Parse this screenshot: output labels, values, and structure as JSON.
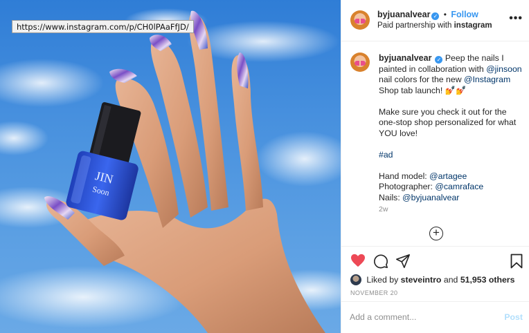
{
  "browser": {
    "url_tooltip": "https://www.instagram.com/p/CH0lPAaFfJD/"
  },
  "photo": {
    "bottle_brand_line1": "JIN",
    "bottle_brand_line2": "Soon"
  },
  "post_header": {
    "username": "byjuanalvear",
    "separator": "•",
    "follow_label": "Follow",
    "partnership_prefix": "Paid partnership with",
    "partner": "instagram",
    "more_label": "•••"
  },
  "caption": {
    "username": "byjuanalvear",
    "line1_text": "Peep the nails I painted in collaboration with ",
    "mention_jinsoon": "@jinsoon",
    "line1_text_b": " nail colors for the new ",
    "mention_instagram": "@Instagram",
    "line1_text_c": " Shop tab launch! 💅💅",
    "paragraph2": "Make sure you check it out for the one-stop shop personalized for what YOU love!",
    "hashtag": "#ad",
    "credit1_label": "Hand model: ",
    "credit1_mention": "@artagee",
    "credit2_label": "Photographer: ",
    "credit2_mention": "@camraface",
    "credit3_label": "Nails: ",
    "credit3_mention": "@byjuanalvear",
    "time_ago": "2w",
    "load_more_label": "+"
  },
  "actions": {
    "liked": true,
    "liked_by_prefix": "Liked by",
    "liked_by_user": "steveintro",
    "liked_by_and": "and",
    "others_count": "51,953 others",
    "date": "NOVEMBER 20"
  },
  "comment": {
    "placeholder": "Add a comment...",
    "post_label": "Post"
  },
  "colors": {
    "link_blue": "#3897f0",
    "mention": "#003569",
    "heart": "#ed4956",
    "muted": "#8e8e8e"
  }
}
